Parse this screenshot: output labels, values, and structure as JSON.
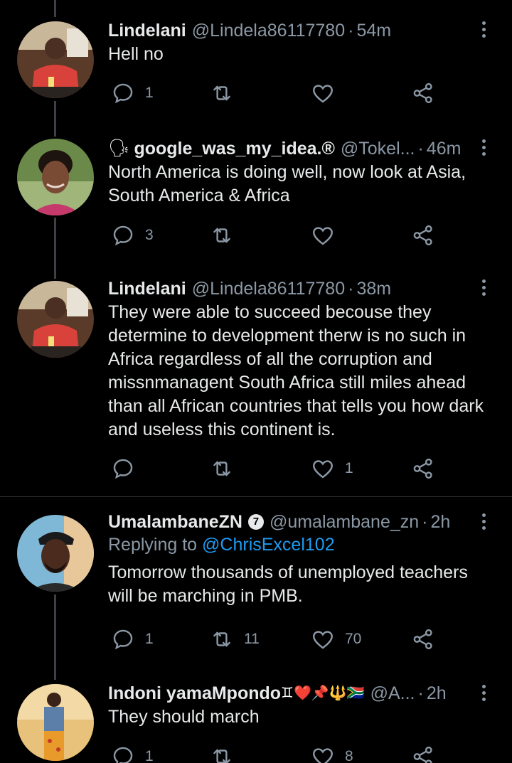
{
  "tweets": [
    {
      "name": "Lindelani",
      "handle": "@Lindela86117780",
      "time": "54m",
      "text": "Hell no",
      "reply_count": "1",
      "retweet_count": "",
      "like_count": ""
    },
    {
      "name_prefix_emoji": "🗣",
      "name": "google_was_my_idea.®",
      "handle": "@Tokel...",
      "time": "46m",
      "text": "North America is doing well, now look at Asia, South America & Africa",
      "reply_count": "3",
      "retweet_count": "",
      "like_count": ""
    },
    {
      "name": "Lindelani",
      "handle": "@Lindela86117780",
      "time": "38m",
      "text": "They were able to succeed becouse they determine to development therw is no such in Africa regardless of all the corruption and missnmanagent South Africa still miles ahead than all African countries that tells you how dark and useless this continent is.",
      "reply_count": "",
      "retweet_count": "",
      "like_count": "1"
    },
    {
      "name": "UmalambaneZN",
      "badge": "7",
      "handle": "@umalambane_zn",
      "time": "2h",
      "replying_prefix": "Replying to",
      "replying_to": "@ChrisExcel102",
      "text": "Tomorrow thousands of unemployed teachers will be marching in PMB.",
      "reply_count": "1",
      "retweet_count": "11",
      "like_count": "70"
    },
    {
      "name": "Indoni yamaMpondo",
      "name_emojis": "♊❤️📌🔱🇿🇦",
      "handle": "@A...",
      "time": "2h",
      "text": "They should march",
      "reply_count": "1",
      "retweet_count": "",
      "like_count": "8"
    }
  ],
  "separator": "·",
  "colors": {
    "background": "#000000",
    "text": "#e7e9ea",
    "secondary": "#8b98a5",
    "link": "#1d9bf0",
    "thread_line": "#3d4145"
  },
  "icons": [
    "reply-icon",
    "retweet-icon",
    "like-icon",
    "share-icon",
    "more-icon"
  ]
}
